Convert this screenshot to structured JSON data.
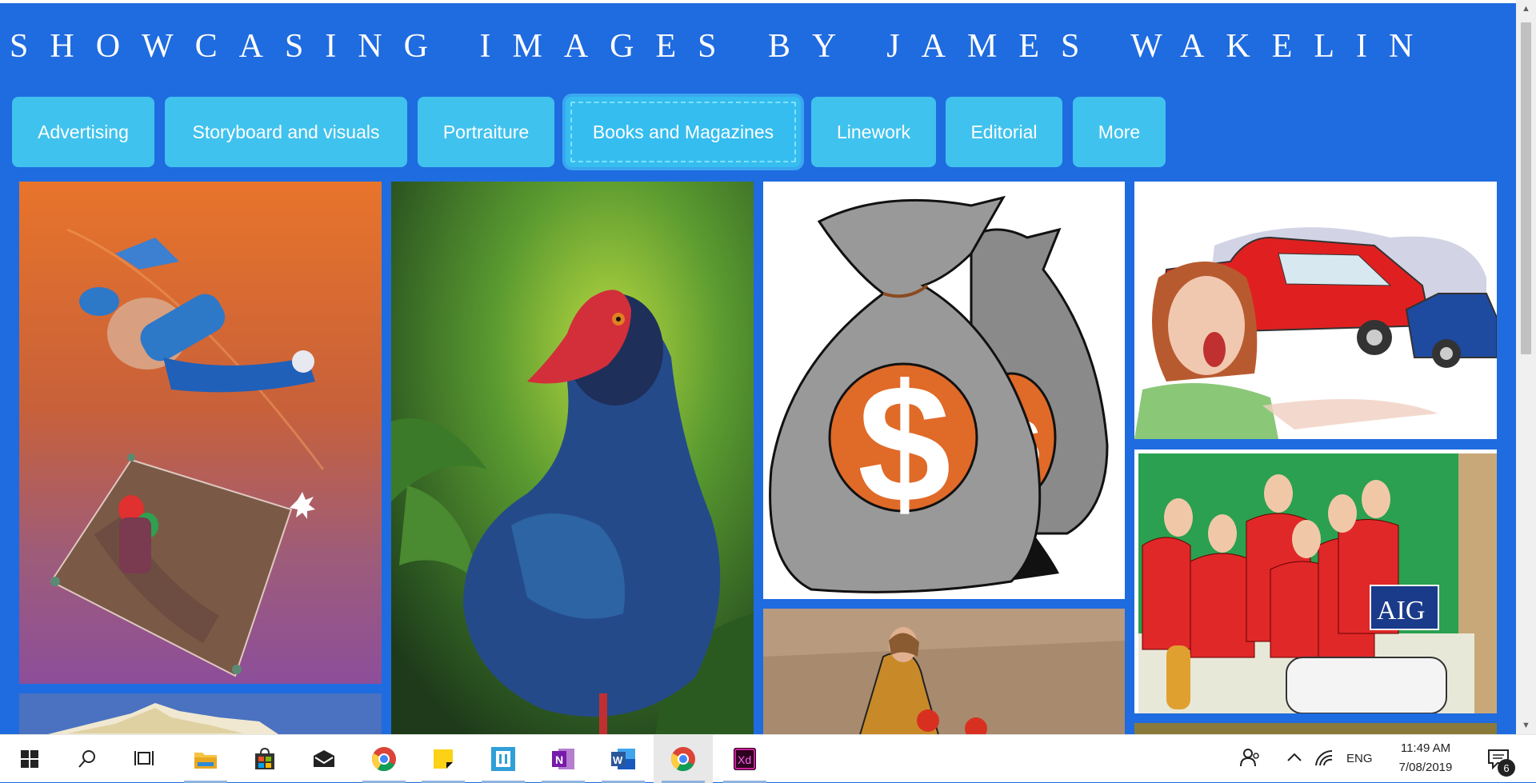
{
  "site": {
    "title": "SHOWCASING IMAGES BY JAMES WAKELIN"
  },
  "nav": {
    "items": [
      "Advertising",
      "Storyboard and visuals",
      "Portraiture",
      "Books and Magazines",
      "Linework",
      "Editorial",
      "More"
    ],
    "active": "Books and Magazines"
  },
  "gallery": {
    "tiles": [
      "wrestler-illustration",
      "pukeko-bird-painting",
      "money-bags-illustration",
      "car-crash-illustration",
      "football-team-illustration",
      "mountain-landscape-illustration",
      "mother-children-illustration"
    ],
    "money_symbol": "$",
    "jersey_text": "AIG"
  },
  "taskbar": {
    "apps": [
      "start",
      "search",
      "task-view",
      "file-explorer",
      "store",
      "mail",
      "chrome",
      "sticky-notes",
      "bracket-app",
      "onenote",
      "word",
      "chrome",
      "adobe-xd"
    ],
    "xd_label": "Xd",
    "word_label": "W",
    "onenote_label": "N",
    "lang": "ENG",
    "time": "11:49 AM",
    "date": "7/08/2019",
    "notification_count": "6"
  },
  "colors": {
    "page_bg": "#1f6be0",
    "nav_button": "#40c2ee",
    "title": "#ffffff"
  }
}
